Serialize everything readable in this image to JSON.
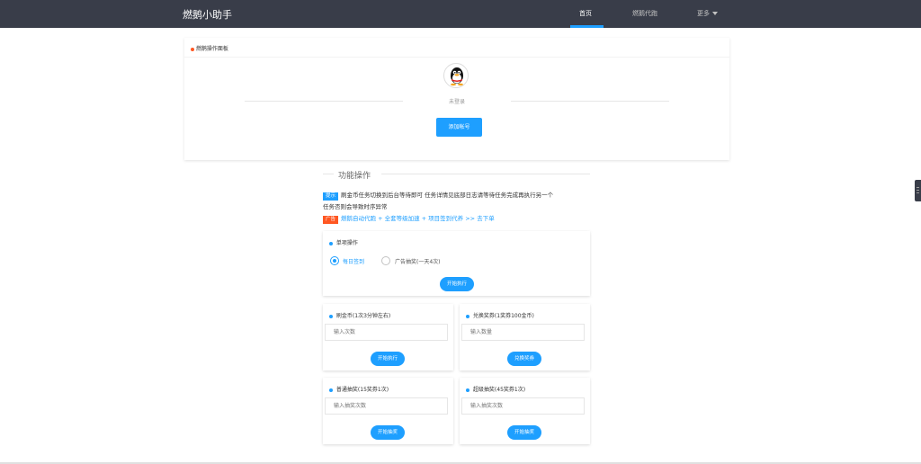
{
  "header": {
    "brand": "燃鹅小助手",
    "nav": [
      "首页",
      "燃鹅代跑",
      "更多"
    ]
  },
  "panel": {
    "title": "燃鹅操作面板",
    "avatar_icon": "qq-penguin-icon",
    "login_status": "未登录",
    "add_account_label": "添加帐号"
  },
  "functions": {
    "section_title": "功能操作",
    "tip_badge": "提示",
    "tip_text_1": "刷金币任务切换到后台等待即可 任务详情见底部日志请等待任务完成再执行另一个",
    "tip_text_2": "任务否则会导致时序异常",
    "ad_badge": "广告",
    "ad_text": "燃鹅自动代跑 + 全套等级加速 + 项目签到代养 >> 去下单"
  },
  "single": {
    "title": "单项操作",
    "options": [
      "每日签到",
      "广告抽奖(一天4次)"
    ],
    "selected_index": 0,
    "button": "开始执行"
  },
  "cards": [
    {
      "title": "刷金币(1次3分钟左右)",
      "placeholder": "输入次数",
      "button": "开始执行"
    },
    {
      "title": "兑换奖券(1奖券100金币)",
      "placeholder": "输入数量",
      "button": "兑换奖券"
    },
    {
      "title": "普通抽奖(15奖券1次)",
      "placeholder": "输入抽奖次数",
      "button": "开始抽奖"
    },
    {
      "title": "超级抽奖(45奖券1次)",
      "placeholder": "输入抽奖次数",
      "button": "开始抽奖"
    }
  ],
  "colors": {
    "topbar": "#393d49",
    "accent": "#1e9fff",
    "ad": "#ff5722"
  }
}
